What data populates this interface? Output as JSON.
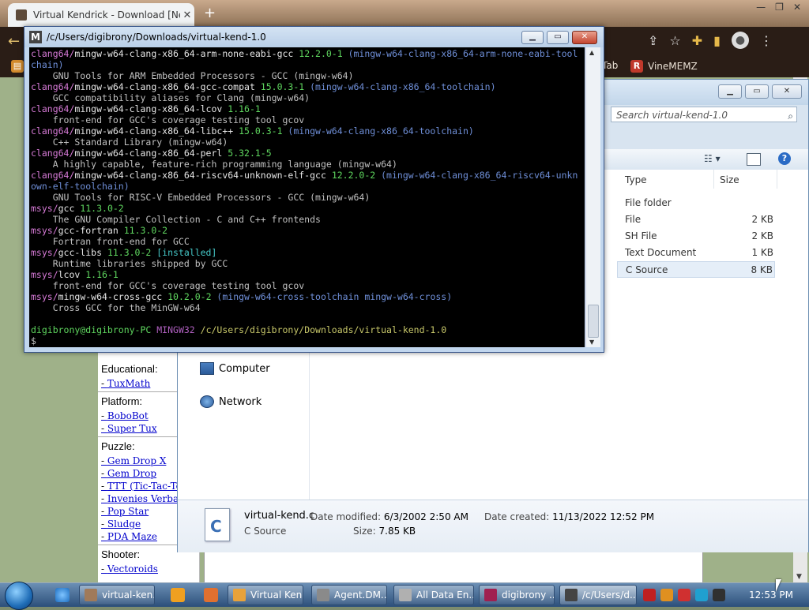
{
  "chrome": {
    "tab_title": "Virtual Kendrick - Download [Ne",
    "tab_close": "✕",
    "new_tab": "+",
    "bookmarks": [
      {
        "label": "Tab"
      },
      {
        "label": "VineMEMZ",
        "icon_letter": "R"
      }
    ]
  },
  "website": {
    "groups": [
      {
        "heading": "Educational:",
        "links": [
          "TuxMath"
        ]
      },
      {
        "heading": "Platform:",
        "links": [
          "BoboBot",
          "Super Tux"
        ]
      },
      {
        "heading": "Puzzle:",
        "links": [
          "Gem Drop X",
          "Gem Drop",
          "TTT (Tic-Tac-To",
          "Invenies Verba",
          "Pop Star",
          "Sludge",
          "PDA Maze"
        ]
      },
      {
        "heading": "Shooter:",
        "links": [
          "Vectoroids"
        ]
      }
    ]
  },
  "explorer": {
    "search_placeholder": "Search virtual-kend-1.0",
    "nav": [
      "Computer",
      "Network"
    ],
    "columns": {
      "type": "Type",
      "size": "Size"
    },
    "files": [
      {
        "type": "File folder",
        "size": ""
      },
      {
        "type": "File",
        "size": "2 KB"
      },
      {
        "type": "SH File",
        "size": "2 KB"
      },
      {
        "type": "Text Document",
        "size": "1 KB"
      },
      {
        "type": "C Source",
        "size": "8 KB",
        "selected": true
      }
    ],
    "details": {
      "name": "virtual-kend.c",
      "type": "C Source",
      "modified_label": "Date modified:",
      "modified": "6/3/2002 2:50 AM",
      "created_label": "Date created:",
      "created": "11/13/2022 12:52 PM",
      "size_label": "Size:",
      "size": "7.85 KB"
    }
  },
  "terminal": {
    "title": "/c/Users/digibrony/Downloads/virtual-kend-1.0",
    "lines": [
      [
        {
          "t": "clang64/",
          "c": "pink"
        },
        {
          "t": "mingw-w64-clang-x86_64-arm-none-eabi-gcc ",
          "c": "white"
        },
        {
          "t": "12.2.0-1 ",
          "c": "green"
        },
        {
          "t": "(mingw-w64-clang-x86_64-arm-none-eabi-tool",
          "c": "blue"
        }
      ],
      [
        {
          "t": "chain)",
          "c": "blue"
        }
      ],
      [
        {
          "t": "    GNU Tools for ARM Embedded Processors - GCC (mingw-w64)",
          "c": "grey"
        }
      ],
      [
        {
          "t": "clang64/",
          "c": "pink"
        },
        {
          "t": "mingw-w64-clang-x86_64-gcc-compat ",
          "c": "white"
        },
        {
          "t": "15.0.3-1 ",
          "c": "green"
        },
        {
          "t": "(mingw-w64-clang-x86_64-toolchain)",
          "c": "blue"
        }
      ],
      [
        {
          "t": "    GCC compatibility aliases for Clang (mingw-w64)",
          "c": "grey"
        }
      ],
      [
        {
          "t": "clang64/",
          "c": "pink"
        },
        {
          "t": "mingw-w64-clang-x86_64-lcov ",
          "c": "white"
        },
        {
          "t": "1.16-1",
          "c": "green"
        }
      ],
      [
        {
          "t": "    front-end for GCC's coverage testing tool gcov",
          "c": "grey"
        }
      ],
      [
        {
          "t": "clang64/",
          "c": "pink"
        },
        {
          "t": "mingw-w64-clang-x86_64-libc++ ",
          "c": "white"
        },
        {
          "t": "15.0.3-1 ",
          "c": "green"
        },
        {
          "t": "(mingw-w64-clang-x86_64-toolchain)",
          "c": "blue"
        }
      ],
      [
        {
          "t": "    C++ Standard Library (mingw-w64)",
          "c": "grey"
        }
      ],
      [
        {
          "t": "clang64/",
          "c": "pink"
        },
        {
          "t": "mingw-w64-clang-x86_64-perl ",
          "c": "white"
        },
        {
          "t": "5.32.1-5",
          "c": "green"
        }
      ],
      [
        {
          "t": "    A highly capable, feature-rich programming language (mingw-w64)",
          "c": "grey"
        }
      ],
      [
        {
          "t": "clang64/",
          "c": "pink"
        },
        {
          "t": "mingw-w64-clang-x86_64-riscv64-unknown-elf-gcc ",
          "c": "white"
        },
        {
          "t": "12.2.0-2 ",
          "c": "green"
        },
        {
          "t": "(mingw-w64-clang-x86_64-riscv64-unkn",
          "c": "blue"
        }
      ],
      [
        {
          "t": "own-elf-toolchain)",
          "c": "blue"
        }
      ],
      [
        {
          "t": "    GNU Tools for RISC-V Embedded Processors - GCC (mingw-w64)",
          "c": "grey"
        }
      ],
      [
        {
          "t": "msys/",
          "c": "pink"
        },
        {
          "t": "gcc ",
          "c": "white"
        },
        {
          "t": "11.3.0-2",
          "c": "green"
        }
      ],
      [
        {
          "t": "    The GNU Compiler Collection - C and C++ frontends",
          "c": "grey"
        }
      ],
      [
        {
          "t": "msys/",
          "c": "pink"
        },
        {
          "t": "gcc-fortran ",
          "c": "white"
        },
        {
          "t": "11.3.0-2",
          "c": "green"
        }
      ],
      [
        {
          "t": "    Fortran front-end for GCC",
          "c": "grey"
        }
      ],
      [
        {
          "t": "msys/",
          "c": "pink"
        },
        {
          "t": "gcc-libs ",
          "c": "white"
        },
        {
          "t": "11.3.0-2 ",
          "c": "green"
        },
        {
          "t": "[installed]",
          "c": "cyan"
        }
      ],
      [
        {
          "t": "    Runtime libraries shipped by GCC",
          "c": "grey"
        }
      ],
      [
        {
          "t": "msys/",
          "c": "pink"
        },
        {
          "t": "lcov ",
          "c": "white"
        },
        {
          "t": "1.16-1",
          "c": "green"
        }
      ],
      [
        {
          "t": "    front-end for GCC's coverage testing tool gcov",
          "c": "grey"
        }
      ],
      [
        {
          "t": "msys/",
          "c": "pink"
        },
        {
          "t": "mingw-w64-cross-gcc ",
          "c": "white"
        },
        {
          "t": "10.2.0-2 ",
          "c": "green"
        },
        {
          "t": "(mingw-w64-cross-toolchain mingw-w64-cross)",
          "c": "blue"
        }
      ],
      [
        {
          "t": "    Cross GCC for the MinGW-w64",
          "c": "grey"
        }
      ],
      [
        {
          "t": "",
          "c": "grey"
        }
      ],
      [
        {
          "t": "digibrony@digibrony-PC ",
          "c": "green"
        },
        {
          "t": "MINGW32 ",
          "c": "purple"
        },
        {
          "t": "/c/Users/digibrony/Downloads/virtual-kend-1.0",
          "c": "yellow"
        }
      ],
      [
        {
          "t": "$ ",
          "c": "grey"
        }
      ]
    ]
  },
  "taskbar": {
    "tasks": [
      {
        "label": "virtual-ken...",
        "icon_color": "#a07a5a"
      },
      {
        "label": "Virtual Ken...",
        "icon_color": "#e8a23a"
      },
      {
        "label": "Agent.DM...",
        "icon_color": "#8a8a8a"
      },
      {
        "label": "All Data En...",
        "icon_color": "#b0b0b0"
      },
      {
        "label": "digibrony ...",
        "icon_color": "#a02050"
      },
      {
        "label": "/c/Users/d...",
        "icon_color": "#444444",
        "active": true
      }
    ],
    "clock": "12:53 PM"
  }
}
